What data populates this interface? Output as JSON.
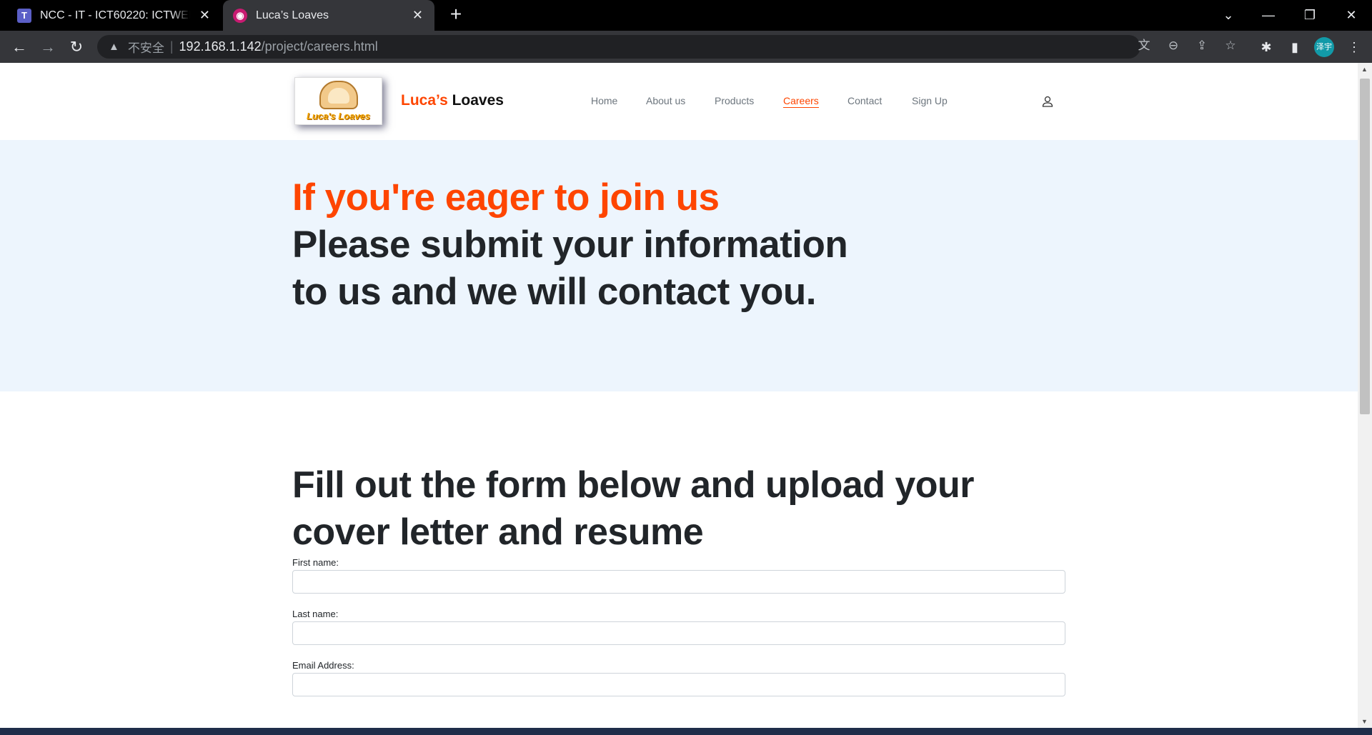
{
  "browser": {
    "tabs": [
      {
        "title": "NCC - IT - ICT60220: ICTWEB5",
        "favicon": "T",
        "active": false
      },
      {
        "title": "Luca’s Loaves",
        "favicon": "◉",
        "active": true
      }
    ],
    "new_tab_glyph": "+",
    "address": {
      "security_label": "不安全",
      "separator": "|",
      "host": "192.168.1.142",
      "path": "/project/careers.html"
    },
    "profile_initials": "泽宇"
  },
  "site": {
    "brand": {
      "accent": "Luca’s",
      "main": "Loaves"
    },
    "logo_text": "Luca's Loaves",
    "nav": [
      {
        "label": "Home",
        "active": false
      },
      {
        "label": "About us",
        "active": false
      },
      {
        "label": "Products",
        "active": false
      },
      {
        "label": "Careers",
        "active": true
      },
      {
        "label": "Contact",
        "active": false
      },
      {
        "label": "Sign Up",
        "active": false
      }
    ],
    "accent_color": "#fe4500"
  },
  "hero": {
    "line1": "If you're eager to join us",
    "line2": "Please submit your information",
    "line3": "to us and we will contact you."
  },
  "form": {
    "heading": "Fill out the form below and upload your cover letter and resume",
    "fields": [
      {
        "label": "First name:",
        "value": ""
      },
      {
        "label": "Last name:",
        "value": ""
      },
      {
        "label": "Email Address:",
        "value": ""
      }
    ]
  }
}
